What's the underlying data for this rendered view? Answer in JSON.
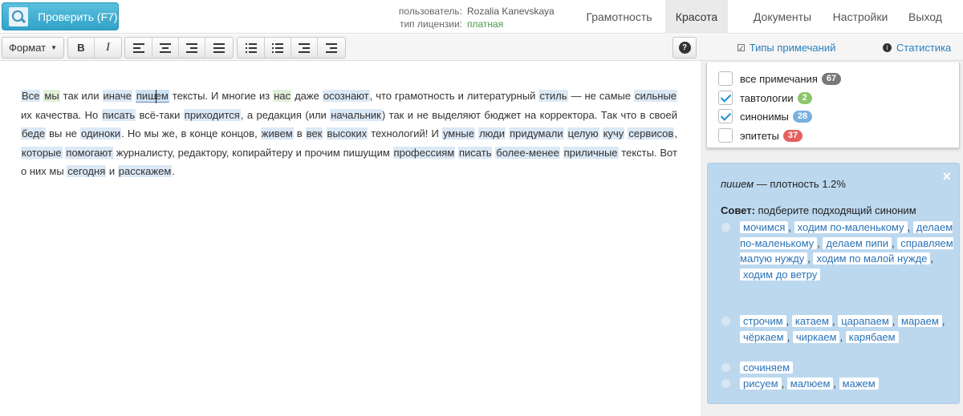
{
  "header": {
    "check_button": "Проверить (F7)",
    "user_label": "пользователь:",
    "user_value": "Rozalia Kanevskaya",
    "license_label": "тип лицензии:",
    "license_value": "платная",
    "tabs": [
      {
        "label": "Грамотность",
        "active": false
      },
      {
        "label": "Красота",
        "active": true
      },
      {
        "label": "Документы",
        "active": false
      },
      {
        "label": "Настройки",
        "active": false
      },
      {
        "label": "Выход",
        "active": false
      }
    ]
  },
  "toolbar": {
    "format_label": "Формат",
    "bold_label": "B",
    "italic_label": "I",
    "help_label": "?",
    "note_types_label": "Типы примечаний",
    "statistics_label": "Статистика"
  },
  "editor": {
    "segments": [
      {
        "t": "Все",
        "h": "w"
      },
      {
        "t": " "
      },
      {
        "t": "мы",
        "h": "g"
      },
      {
        "t": " так или "
      },
      {
        "t": "иначе",
        "h": "w"
      },
      {
        "t": " "
      },
      {
        "t": "пишем",
        "h": "sel"
      },
      {
        "t": " тексты. И многие из "
      },
      {
        "t": "нас",
        "h": "g"
      },
      {
        "t": " даже "
      },
      {
        "t": "осознают",
        "h": "w"
      },
      {
        "t": ", что грамотность и литературный "
      },
      {
        "t": "стиль",
        "h": "w"
      },
      {
        "t": " — не самые "
      },
      {
        "t": "сильные",
        "h": "w"
      },
      {
        "t": " их качества. Но "
      },
      {
        "t": "писать",
        "h": "w"
      },
      {
        "t": " всё-таки "
      },
      {
        "t": "приходится",
        "h": "w"
      },
      {
        "t": ", а редакция (или "
      },
      {
        "t": "начальник",
        "h": "w"
      },
      {
        "t": ") так и не выделяют бюджет на корректора. Так что в своей "
      },
      {
        "t": "беде",
        "h": "w"
      },
      {
        "t": " вы не "
      },
      {
        "t": "одиноки",
        "h": "w"
      },
      {
        "t": ". Но мы же, в конце концов, "
      },
      {
        "t": "живем",
        "h": "w"
      },
      {
        "t": " в "
      },
      {
        "t": "век",
        "h": "w"
      },
      {
        "t": " "
      },
      {
        "t": "высоких",
        "h": "w"
      },
      {
        "t": " технологий! И "
      },
      {
        "t": "умные",
        "h": "w"
      },
      {
        "t": " "
      },
      {
        "t": "люди",
        "h": "w"
      },
      {
        "t": " "
      },
      {
        "t": "придумали",
        "h": "w"
      },
      {
        "t": " "
      },
      {
        "t": "целую",
        "h": "w"
      },
      {
        "t": " "
      },
      {
        "t": "кучу",
        "h": "w"
      },
      {
        "t": " "
      },
      {
        "t": "сервисов",
        "h": "w"
      },
      {
        "t": ", "
      },
      {
        "t": "которые",
        "h": "w"
      },
      {
        "t": " "
      },
      {
        "t": "помогают",
        "h": "w"
      },
      {
        "t": " журналисту, редактору, копирайтеру и прочим пишущим "
      },
      {
        "t": "профессиям",
        "h": "w"
      },
      {
        "t": " "
      },
      {
        "t": "писать",
        "h": "w"
      },
      {
        "t": " "
      },
      {
        "t": "более-менее",
        "h": "w"
      },
      {
        "t": " "
      },
      {
        "t": "приличные",
        "h": "w"
      },
      {
        "t": " тексты. Вот о них мы "
      },
      {
        "t": "сегодня",
        "h": "w"
      },
      {
        "t": "  и "
      },
      {
        "t": "расскажем",
        "h": "w"
      },
      {
        "t": "."
      }
    ]
  },
  "filters": [
    {
      "label": "все примечания",
      "count": "67",
      "checked": false,
      "color": "#777777"
    },
    {
      "label": "тавтологии",
      "count": "2",
      "checked": true,
      "color": "#8cc66b"
    },
    {
      "label": "синонимы",
      "count": "28",
      "checked": true,
      "color": "#7bb0dc"
    },
    {
      "label": "эпитеты",
      "count": "37",
      "checked": false,
      "color": "#e4605e"
    }
  ],
  "suggestion": {
    "close": "×",
    "word": "пишем",
    "density_text": " — плотность 1.2%",
    "advice_bold": "Совет:",
    "advice_text": " подберите подходящий синоним",
    "options": [
      [
        "мочимся",
        "ходим по-маленькому",
        "делаем по-маленькому",
        "делаем пипи",
        "справляем малую нужду",
        "ходим по малой нужде",
        "ходим до ветру"
      ],
      [
        "строчим",
        "катаем",
        "царапаем",
        "мараем",
        "чёркаем",
        "чиркаем",
        "карябаем"
      ],
      [
        "сочиняем"
      ],
      [
        "рисуем",
        "малюем",
        "мажем"
      ]
    ]
  }
}
